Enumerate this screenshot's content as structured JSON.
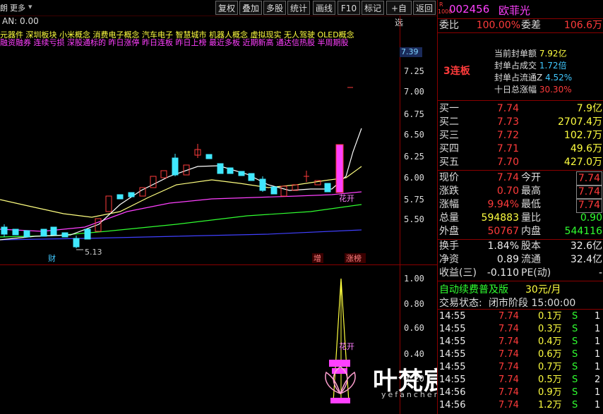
{
  "toolbar": {
    "left_labels": [
      "朗",
      "更多"
    ],
    "buttons": [
      "复权",
      "叠加",
      "多股",
      "统计",
      "画线",
      "F10",
      "标记",
      "+自选",
      "返回"
    ]
  },
  "indicator_label": "AN: 0.00",
  "concepts_line1": "元器件   深圳板块  小米概念 消费电子概念 汽车电子 智慧城市 机器人概念 虚拟现实 无人驾驶 OLED概念",
  "concepts_line2": "融资融券 连续亏损 深股通标的 昨日涨停 昨日连板 昨日上榜 最近多板 近期新高 通达信热股 半周期股",
  "price_axis": [
    "7.25",
    "7.00",
    "6.75",
    "6.50",
    "6.25",
    "6.00",
    "5.75",
    "5.50"
  ],
  "price_tag": "7.39",
  "low_label": "5.13",
  "lower_axis": [
    "1.00",
    "0.80",
    "0.60",
    "0.40",
    "0.20"
  ],
  "event_markers": {
    "cai": "财",
    "zeng": "增",
    "zhangbang": "涨榜"
  },
  "huakai": "花开",
  "stock": {
    "code_prefix": "R",
    "code_small": "1000",
    "code": "002456",
    "name": "欧菲光"
  },
  "weibi": {
    "label": "委比",
    "value": "100.00%",
    "label2": "委差",
    "value2": "106.6万"
  },
  "seal": {
    "tag": "3连板",
    "items": [
      {
        "label": "当前封单额",
        "value": "7.92亿"
      },
      {
        "label": "封单占成交",
        "value": "1.72倍"
      },
      {
        "label": "封单占流通Z",
        "value": "4.52%"
      },
      {
        "label": "十日总涨幅",
        "value": "30.30%"
      }
    ]
  },
  "bids": [
    {
      "label": "买一",
      "price": "7.74",
      "vol": "7.9亿"
    },
    {
      "label": "买二",
      "price": "7.73",
      "vol": "2707.4万"
    },
    {
      "label": "买三",
      "price": "7.72",
      "vol": "102.7万"
    },
    {
      "label": "买四",
      "price": "7.71",
      "vol": "49.6万"
    },
    {
      "label": "买五",
      "price": "7.70",
      "vol": "427.0万"
    }
  ],
  "quote": [
    {
      "l": "现价",
      "v1": "7.74",
      "l2": "今开",
      "v2": "7.74"
    },
    {
      "l": "涨跌",
      "v1": "0.70",
      "l2": "最高",
      "v2": "7.74"
    },
    {
      "l": "涨幅",
      "v1": "9.94%",
      "l2": "最低",
      "v2": "7.74"
    },
    {
      "l": "总量",
      "v1": "594883",
      "l2": "量比",
      "v2": "0.90"
    },
    {
      "l": "外盘",
      "v1": "50767",
      "l2": "内盘",
      "v2": "544116"
    }
  ],
  "fund": [
    {
      "l": "换手",
      "v1": "1.84%",
      "l2": "股本",
      "v2": "32.6亿"
    },
    {
      "l": "净资",
      "v1": "0.89",
      "l2": "流通",
      "v2": "32.4亿"
    },
    {
      "l": "收益(三)",
      "v1": "-0.110",
      "l2": "PE(动)",
      "v2": "-"
    }
  ],
  "promo": {
    "text": "自动续费普及版",
    "price": "30元/月"
  },
  "status": {
    "label": "交易状态:",
    "value": "闭市阶段 15:00:00"
  },
  "trades": [
    {
      "t": "14:55",
      "p": "7.74",
      "v": "0.1万",
      "s": "S",
      "n": "1"
    },
    {
      "t": "14:55",
      "p": "7.74",
      "v": "0.3万",
      "s": "S",
      "n": "1"
    },
    {
      "t": "14:55",
      "p": "7.74",
      "v": "0.4万",
      "s": "S",
      "n": "1"
    },
    {
      "t": "14:55",
      "p": "7.74",
      "v": "0.6万",
      "s": "S",
      "n": "1"
    },
    {
      "t": "14:55",
      "p": "7.74",
      "v": "0.7万",
      "s": "S",
      "n": "1"
    },
    {
      "t": "14:55",
      "p": "7.74",
      "v": "0.5万",
      "s": "S",
      "n": "2"
    },
    {
      "t": "14:56",
      "p": "7.74",
      "v": "0.9万",
      "s": "S",
      "n": "1"
    },
    {
      "t": "14:56",
      "p": "7.74",
      "v": "1.2万",
      "s": "S",
      "n": "1"
    }
  ],
  "watermark": {
    "title": "叶梵宸指标公式网",
    "url": "yefanchen.com"
  },
  "colors": {
    "up": "#ff3b3b",
    "down": "#40e8ff",
    "price": "#ffff40",
    "ma5": "#ffffff",
    "ma10": "#ffff80",
    "ma20": "#ff40ff",
    "ma30": "#30ff30",
    "ma60": "#4040ff"
  }
}
